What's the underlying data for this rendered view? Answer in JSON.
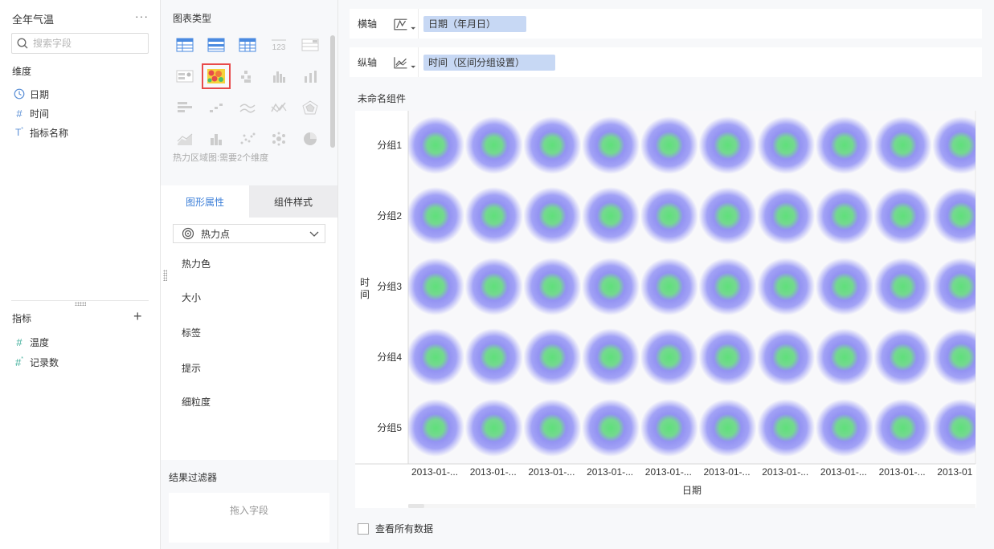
{
  "datasource": {
    "name": "全年气温",
    "more_label": "···"
  },
  "search": {
    "placeholder": "搜索字段"
  },
  "dimensions": {
    "label": "维度",
    "items": [
      {
        "label": "日期",
        "icon": "clock-icon"
      },
      {
        "label": "时间",
        "icon": "hash-icon"
      },
      {
        "label": "指标名称",
        "icon": "text-field-icon"
      }
    ]
  },
  "indicators": {
    "label": "指标",
    "add_label": "+",
    "items": [
      {
        "label": "温度",
        "icon": "hash-icon"
      },
      {
        "label": "记录数",
        "icon": "hash-star-icon"
      }
    ]
  },
  "chart_types": {
    "title": "图表类型",
    "hint": "热力区域图:需要2个维度",
    "selected": "heat-area-chart"
  },
  "prop_tabs": {
    "shape": "图形属性",
    "style": "组件样式"
  },
  "shape_select": {
    "value": "热力点"
  },
  "properties": [
    "热力色",
    "大小",
    "标签",
    "提示",
    "细粒度"
  ],
  "filter": {
    "title": "结果过滤器",
    "drop_hint": "拖入字段"
  },
  "axes": {
    "x": {
      "label": "横轴",
      "field": "日期（年月日）"
    },
    "y": {
      "label": "纵轴",
      "field": "时间（区间分组设置）"
    }
  },
  "component_title": "未命名组件",
  "show_all_data": "查看所有数据",
  "colors": {
    "accent": "#3d7fd8",
    "pill": "#c7d8f4",
    "heat_outer": "#8c8cf5",
    "heat_inner": "#5fe07a"
  },
  "chart_data": {
    "type": "heatmap",
    "xlabel": "日期",
    "ylabel": "时间",
    "y_categories": [
      "分组1",
      "分组2",
      "分组3",
      "分组4",
      "分组5"
    ],
    "x_categories": [
      "2013-01-...",
      "2013-01-...",
      "2013-01-...",
      "2013-01-...",
      "2013-01-...",
      "2013-01-...",
      "2013-01-...",
      "2013-01-...",
      "2013-01-...",
      "2013-01"
    ]
  }
}
